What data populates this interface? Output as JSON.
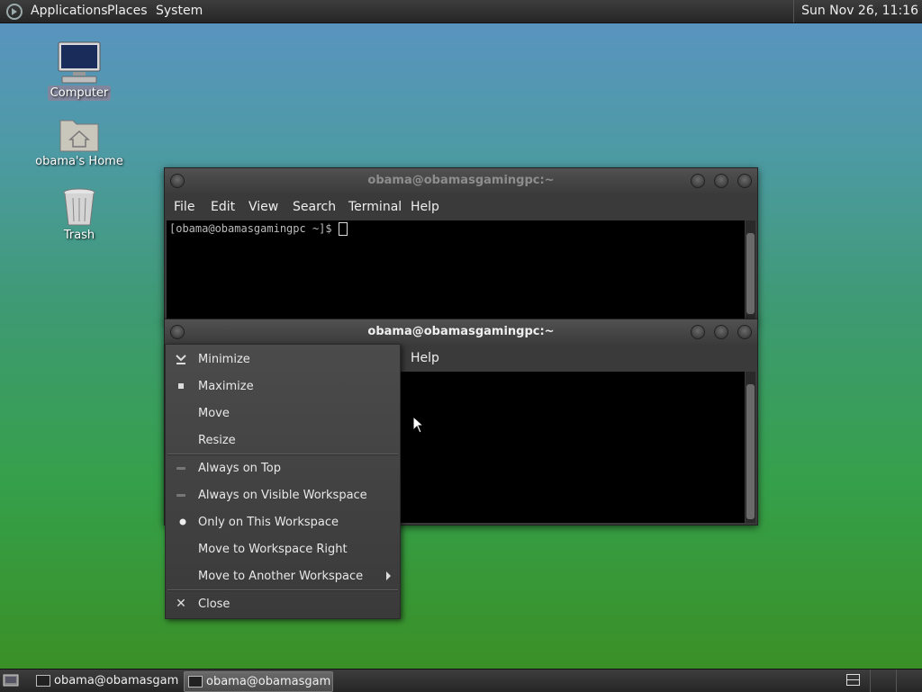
{
  "top_panel": {
    "menus": [
      "Applications",
      "Places",
      "System"
    ],
    "clock": "Sun Nov 26, 11:16"
  },
  "desktop": {
    "icons": [
      {
        "label": "Computer",
        "icon": "computer-icon"
      },
      {
        "label": "obama's Home",
        "icon": "home-folder-icon"
      },
      {
        "label": "Trash",
        "icon": "trash-icon"
      }
    ]
  },
  "window_back": {
    "title": "obama@obamasgamingpc:~",
    "menus": [
      "File",
      "Edit",
      "View",
      "Search",
      "Terminal",
      "Help"
    ],
    "prompt": "[obama@obamasgamingpc ~]$ "
  },
  "window_front": {
    "title": "obama@obamasgamingpc:~",
    "visible_menu": "Help"
  },
  "context_menu": {
    "items": [
      {
        "label": "Minimize",
        "icon": "minimize-icon"
      },
      {
        "label": "Maximize",
        "icon": "maximize-icon"
      },
      {
        "label": "Move"
      },
      {
        "label": "Resize"
      },
      {
        "label": "Always on Top",
        "icon": "radio-off-icon"
      },
      {
        "label": "Always on Visible Workspace",
        "icon": "radio-off-icon"
      },
      {
        "label": "Only on This Workspace",
        "icon": "radio-on-icon"
      },
      {
        "label": "Move to Workspace Right"
      },
      {
        "label": "Move to Another Workspace",
        "icon": "submenu-arrow-icon"
      },
      {
        "label": "Close",
        "icon": "close-icon"
      }
    ]
  },
  "taskbar": {
    "tasks": [
      {
        "label": "obama@obamasgam..."
      },
      {
        "label": "obama@obamasgam..."
      }
    ]
  },
  "colors": {
    "panel": "#2e2e2e",
    "menu_bg": "#444444",
    "terminal_bg": "#000000"
  }
}
